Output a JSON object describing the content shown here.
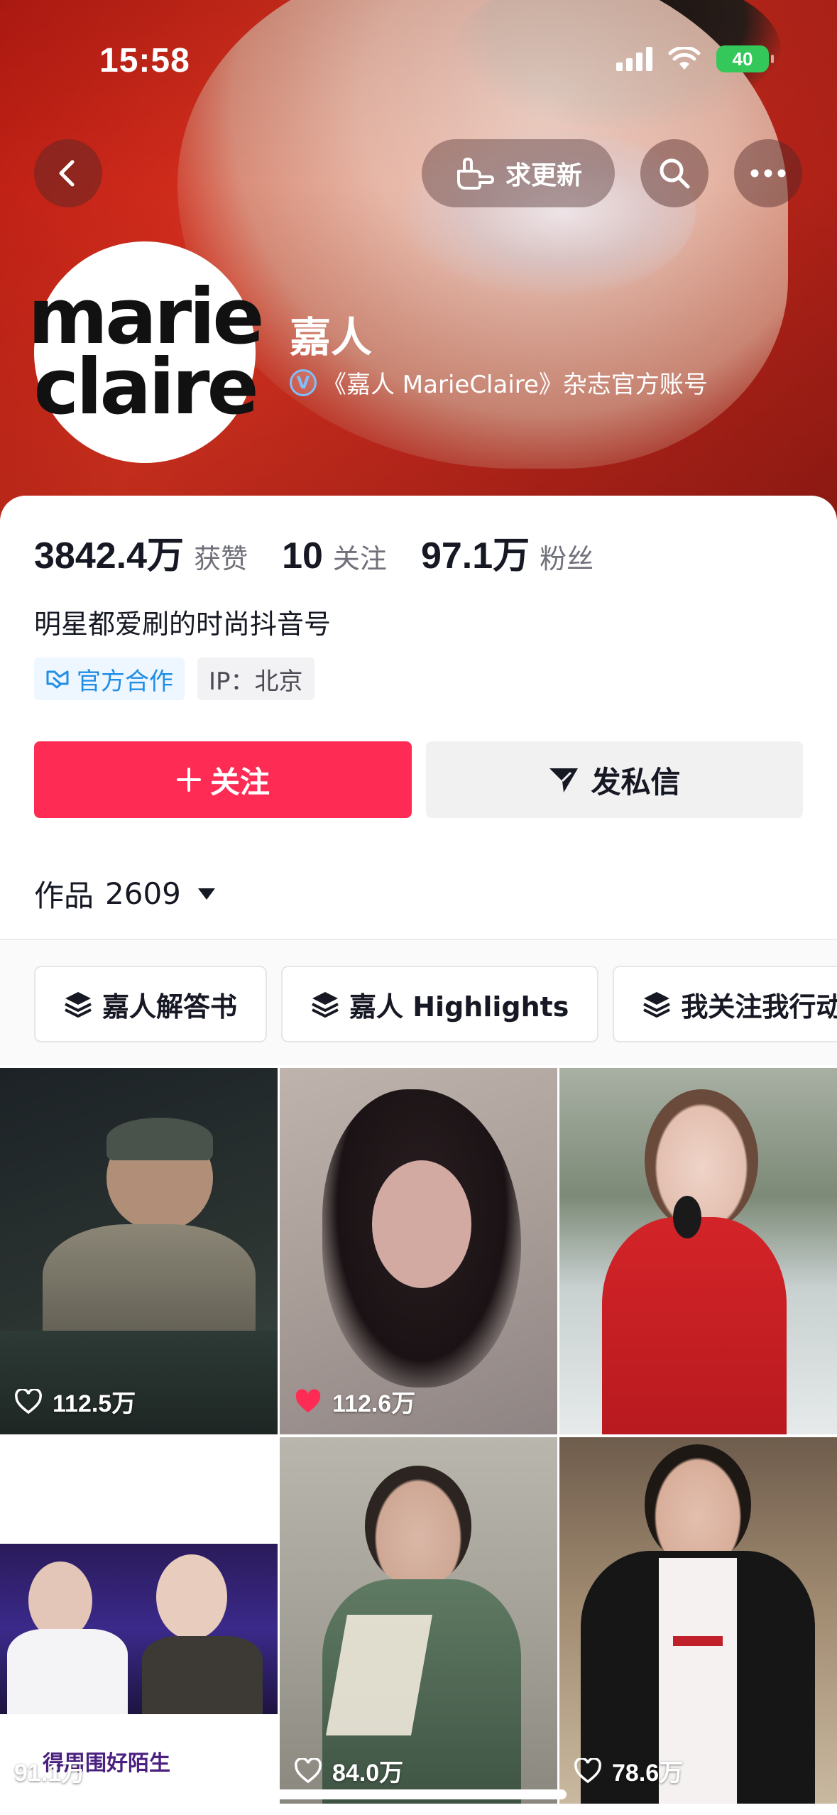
{
  "status_bar": {
    "time": "15:58",
    "battery": "40"
  },
  "nav": {
    "request_update_label": "求更新"
  },
  "avatar": {
    "line1": "marie",
    "line2": "claire"
  },
  "profile": {
    "name": "嘉人",
    "verified_badge": "V",
    "verified_text": "《嘉人 MarieClaire》杂志官方账号",
    "bio": "明星都爱刷的时尚抖音号"
  },
  "stats": {
    "likes_value": "3842.4万",
    "likes_label": "获赞",
    "following_value": "10",
    "following_label": "关注",
    "followers_value": "97.1万",
    "followers_label": "粉丝"
  },
  "tags": {
    "official": "官方合作",
    "ip": "IP：北京"
  },
  "actions": {
    "follow": "关注",
    "message": "发私信"
  },
  "works": {
    "label": "作品",
    "count": "2609"
  },
  "collections": [
    "嘉人解答书",
    "嘉人 Highlights",
    "我关注我行动"
  ],
  "videos": [
    {
      "likes": "112.5万",
      "liked": false
    },
    {
      "likes": "112.6万",
      "liked": true
    },
    {
      "likes": "",
      "liked": false
    },
    {
      "likes": "91.1万",
      "liked": false,
      "caption": "得周围好陌生"
    },
    {
      "likes": "84.0万",
      "liked": false
    },
    {
      "likes": "78.6万",
      "liked": false
    }
  ],
  "colors": {
    "accent": "#fe2c55",
    "official": "#1f8ee6"
  }
}
